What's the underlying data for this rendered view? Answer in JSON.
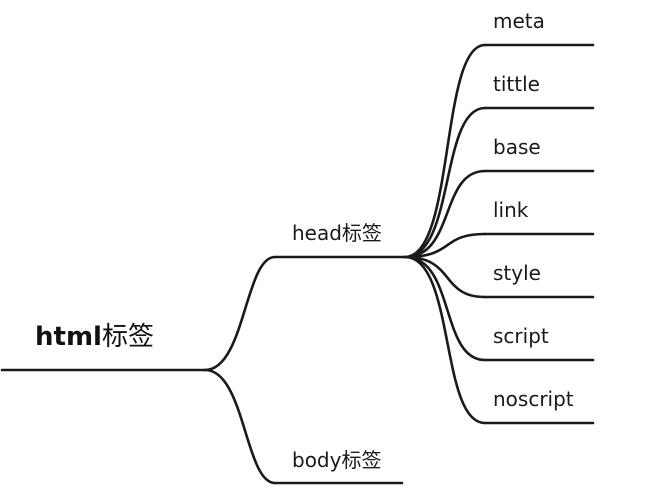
{
  "root": {
    "label_bold": "html",
    "label_rest": "标签"
  },
  "branches": [
    {
      "label": "head标签",
      "children": [
        "meta",
        "tittle",
        "base",
        "link",
        "style",
        "script",
        "noscript"
      ]
    },
    {
      "label": "body标签",
      "children": []
    }
  ],
  "colors": {
    "line": "#1a1a1a",
    "text": "#1a1a1a",
    "background": "#ffffff"
  }
}
